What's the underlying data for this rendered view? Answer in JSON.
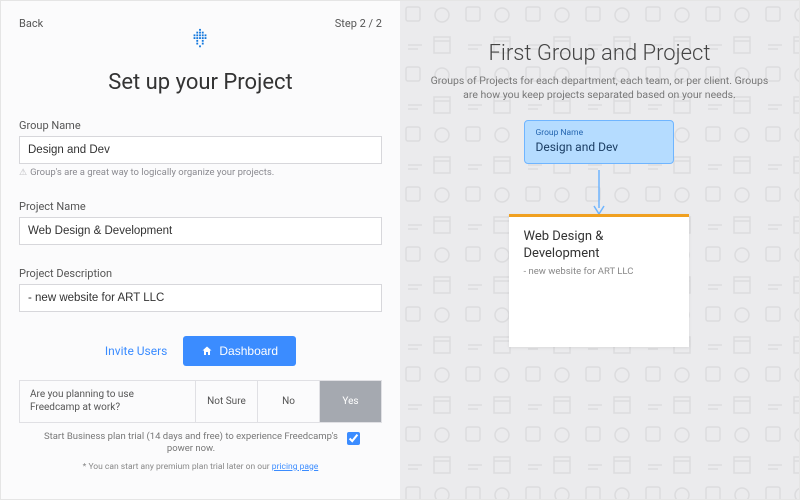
{
  "topbar": {
    "back": "Back",
    "step": "Step 2 / 2"
  },
  "title": "Set up your Project",
  "group": {
    "label": "Group Name",
    "value": "Design and Dev",
    "hint": "Group's are a great way to logically organize your projects."
  },
  "project": {
    "label": "Project Name",
    "value": "Web Design & Development"
  },
  "description": {
    "label": "Project Description",
    "value": "- new website for ART LLC"
  },
  "actions": {
    "invite": "Invite Users",
    "dashboard": "Dashboard"
  },
  "survey": {
    "question": "Are you planning to use Freedcamp at work?",
    "options": [
      "Not Sure",
      "No",
      "Yes"
    ],
    "selected": 2
  },
  "trial": {
    "text": "Start Business plan trial (14 days and free) to experience Freedcamp's power now.",
    "checked": true,
    "note_prefix": "* You can start any premium plan trial later on our ",
    "note_link": "pricing page"
  },
  "right": {
    "heading": "First Group and Project",
    "sub": "Groups of Projects for each department, each team, or per client. Groups are how you keep projects separated based on your needs.",
    "group_label": "Group Name",
    "group_value": "Design and Dev",
    "project_title": "Web Design & Development",
    "project_desc": "- new website for ART LLC"
  },
  "colors": {
    "accent": "#3b8cff",
    "orange": "#f0a020"
  }
}
